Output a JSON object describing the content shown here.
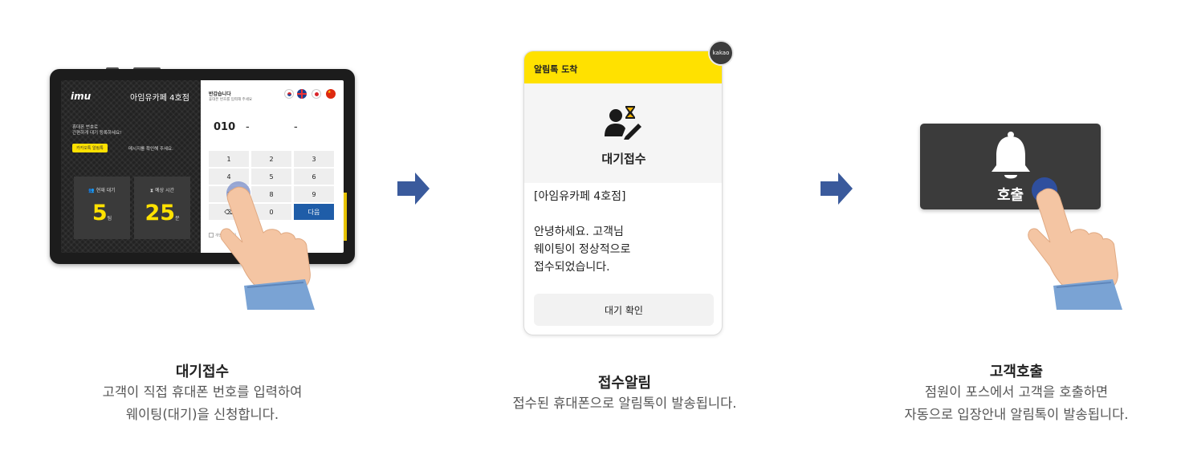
{
  "steps": [
    {
      "title": "대기접수",
      "desc_line1": "고객이 직접 휴대폰 번호를 입력하여",
      "desc_line2": "웨이팅(대기)을 신청합니다."
    },
    {
      "title": "접수알림",
      "desc_line1": "접수된 휴대폰으로 알림톡이 발송됩니다."
    },
    {
      "title": "고객호출",
      "desc_line1": "점원이 포스에서 고객을 호출하면",
      "desc_line2": "자동으로 입장안내 알림톡이 발송됩니다."
    }
  ],
  "tablet": {
    "logo": "imu",
    "store_name": "아임유카페 4호점",
    "guide_line1": "휴대폰 번호로",
    "guide_line2": "간편하게 대기 등록하세요!",
    "kakao_badge": "카카오톡 알림톡",
    "kakao_desc": "메시지를 확인해 주세요.",
    "current_wait_label": "현재 대기",
    "current_wait_value": "5",
    "current_wait_unit": "팀",
    "expected_time_label": "예상 시간",
    "expected_time_value": "25",
    "expected_time_unit": "분",
    "greeting": "반갑습니다",
    "greeting_sub": "휴대폰 번호를 입력해 주세요",
    "phone_prefix": "010",
    "dash": "-",
    "keys": [
      "1",
      "2",
      "3",
      "4",
      "5",
      "6",
      "7",
      "8",
      "9",
      "⌫",
      "0",
      "다음"
    ],
    "consent": "개인정보 수집"
  },
  "kakao_card": {
    "header": "알림톡 도착",
    "badge": "kakao",
    "hero_title": "대기접수",
    "store_line": "[아임유카페 4호점]",
    "msg_line1": "안녕하세요. 고객님",
    "msg_line2": "웨이팅이 정상적으로",
    "msg_line3": "접수되었습니다.",
    "button": "대기 확인"
  },
  "call_pad": {
    "label": "호출"
  },
  "colors": {
    "arrow": "#3a5a9c",
    "kakao_yellow": "#ffe100",
    "keypad_next": "#1f5da8",
    "stat_value": "#ffe100"
  },
  "icons": [
    "hand-pointer-icon",
    "arrow-right-icon",
    "user-hourglass-icon",
    "bell-icon",
    "user-group-icon",
    "hourglass-icon",
    "backspace-icon",
    "korea-flag-icon",
    "uk-flag-icon",
    "japan-flag-icon",
    "china-flag-icon"
  ]
}
